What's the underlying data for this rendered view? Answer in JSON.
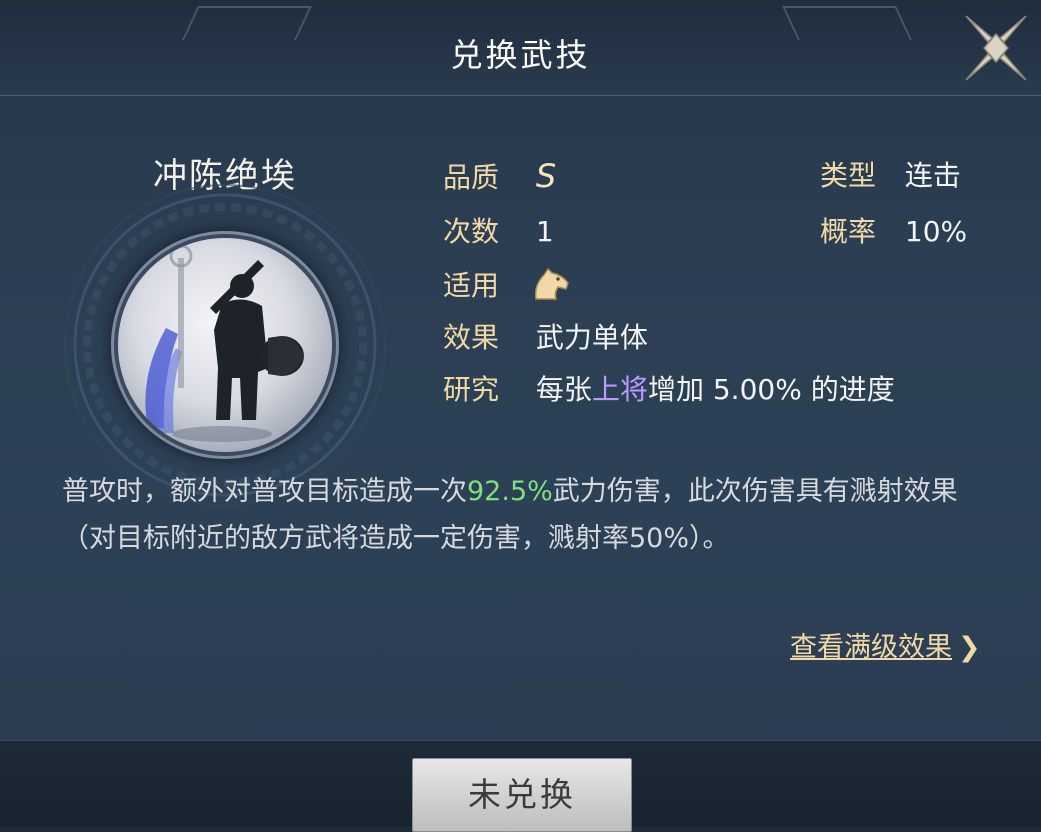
{
  "window": {
    "title": "兑换武技"
  },
  "skill": {
    "name": "冲陈绝埃"
  },
  "attributes": {
    "quality": {
      "label": "品质",
      "value": "S"
    },
    "type": {
      "label": "类型",
      "value": "连击"
    },
    "count": {
      "label": "次数",
      "value": "1"
    },
    "chance": {
      "label": "概率",
      "value": "10%"
    },
    "applicable": {
      "label": "适用",
      "icon": "horse-icon"
    },
    "effect": {
      "label": "效果",
      "value": "武力单体"
    },
    "research": {
      "label": "研究",
      "prefix": "每张",
      "highlight": "上将",
      "suffix": "增加 5.00% 的进度"
    }
  },
  "description": {
    "part1": "普攻时，额外对普攻目标造成一次",
    "highlight": "92.5%",
    "part2": "武力伤害，此次伤害具有溅射效果（对目标附近的敌方武将造成一定伤害，溅射率50%）。"
  },
  "links": {
    "full_effect": "查看满级效果",
    "chevron": "❯"
  },
  "buttons": {
    "status": "未兑换"
  },
  "colors": {
    "highlight_green": "#7fe07c",
    "highlight_purple": "#b79bff",
    "label_gold": "#f0d9a6"
  }
}
